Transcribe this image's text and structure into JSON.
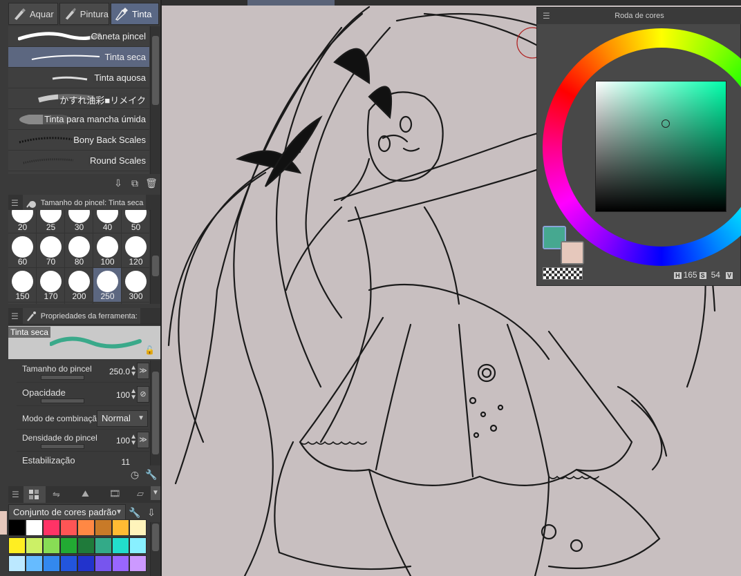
{
  "tool_tabs": [
    {
      "label": "Aquar",
      "icon": "watercolor-brush-icon"
    },
    {
      "label": "Pintura",
      "icon": "paint-brush-icon"
    },
    {
      "label": "Tinta",
      "icon": "ink-pen-icon"
    }
  ],
  "brushes": [
    {
      "label": "Caneta pincel",
      "selected": false
    },
    {
      "label": "Tinta seca",
      "selected": true
    },
    {
      "label": "Tinta aquosa",
      "selected": false
    },
    {
      "label": "かすれ油彩■リメイク",
      "selected": false
    },
    {
      "label": "Tinta para mancha úmida",
      "selected": false
    },
    {
      "label": "Bony Back Scales",
      "selected": false
    },
    {
      "label": "Round Scales",
      "selected": false
    }
  ],
  "brush_size_panel": {
    "title": "Tamanho do pincel: Tinta seca"
  },
  "brush_sizes": [
    {
      "value": "20"
    },
    {
      "value": "25"
    },
    {
      "value": "30"
    },
    {
      "value": "40"
    },
    {
      "value": "50"
    },
    {
      "value": "60"
    },
    {
      "value": "70"
    },
    {
      "value": "80"
    },
    {
      "value": "100"
    },
    {
      "value": "120"
    },
    {
      "value": "150"
    },
    {
      "value": "170"
    },
    {
      "value": "200"
    },
    {
      "value": "250",
      "selected": true
    },
    {
      "value": "300"
    }
  ],
  "tool_properties": {
    "title": "Propriedades da ferramenta:",
    "tool_name": "Tinta seca",
    "brush_size": {
      "label": "Tamanho do pincel",
      "value": "250.0"
    },
    "opacity": {
      "label": "Opacidade",
      "value": "100"
    },
    "blend_mode": {
      "label": "Modo de combinação",
      "value": "Normal"
    },
    "brush_density": {
      "label": "Densidade do pincel",
      "value": "100"
    },
    "stabilization": {
      "label": "Estabilização",
      "value": "11"
    }
  },
  "color_set": {
    "selected": "Conjunto de cores padrão"
  },
  "palette_colors": [
    "#000000",
    "#ffffff",
    "#ff3366",
    "#ff5555",
    "#ff8844",
    "#c87a28",
    "#ffbb33",
    "#fff4bb",
    "#ffee22",
    "#ccf066",
    "#88dd55",
    "#22aa33",
    "#1f7a3a",
    "#33aa88",
    "#22ddcc",
    "#88f0ff",
    "#bbe8ff",
    "#66bbff",
    "#3388ee",
    "#2255dd",
    "#2233cc",
    "#7755ee",
    "#9966ff",
    "#cc99ff"
  ],
  "color_wheel": {
    "title": "Roda de cores",
    "main_color": "#46a890",
    "sub_color": "#e6c8bc",
    "h_label": "H",
    "h_value": "165",
    "s_label": "S",
    "s_value": "54",
    "v_label": "V"
  }
}
